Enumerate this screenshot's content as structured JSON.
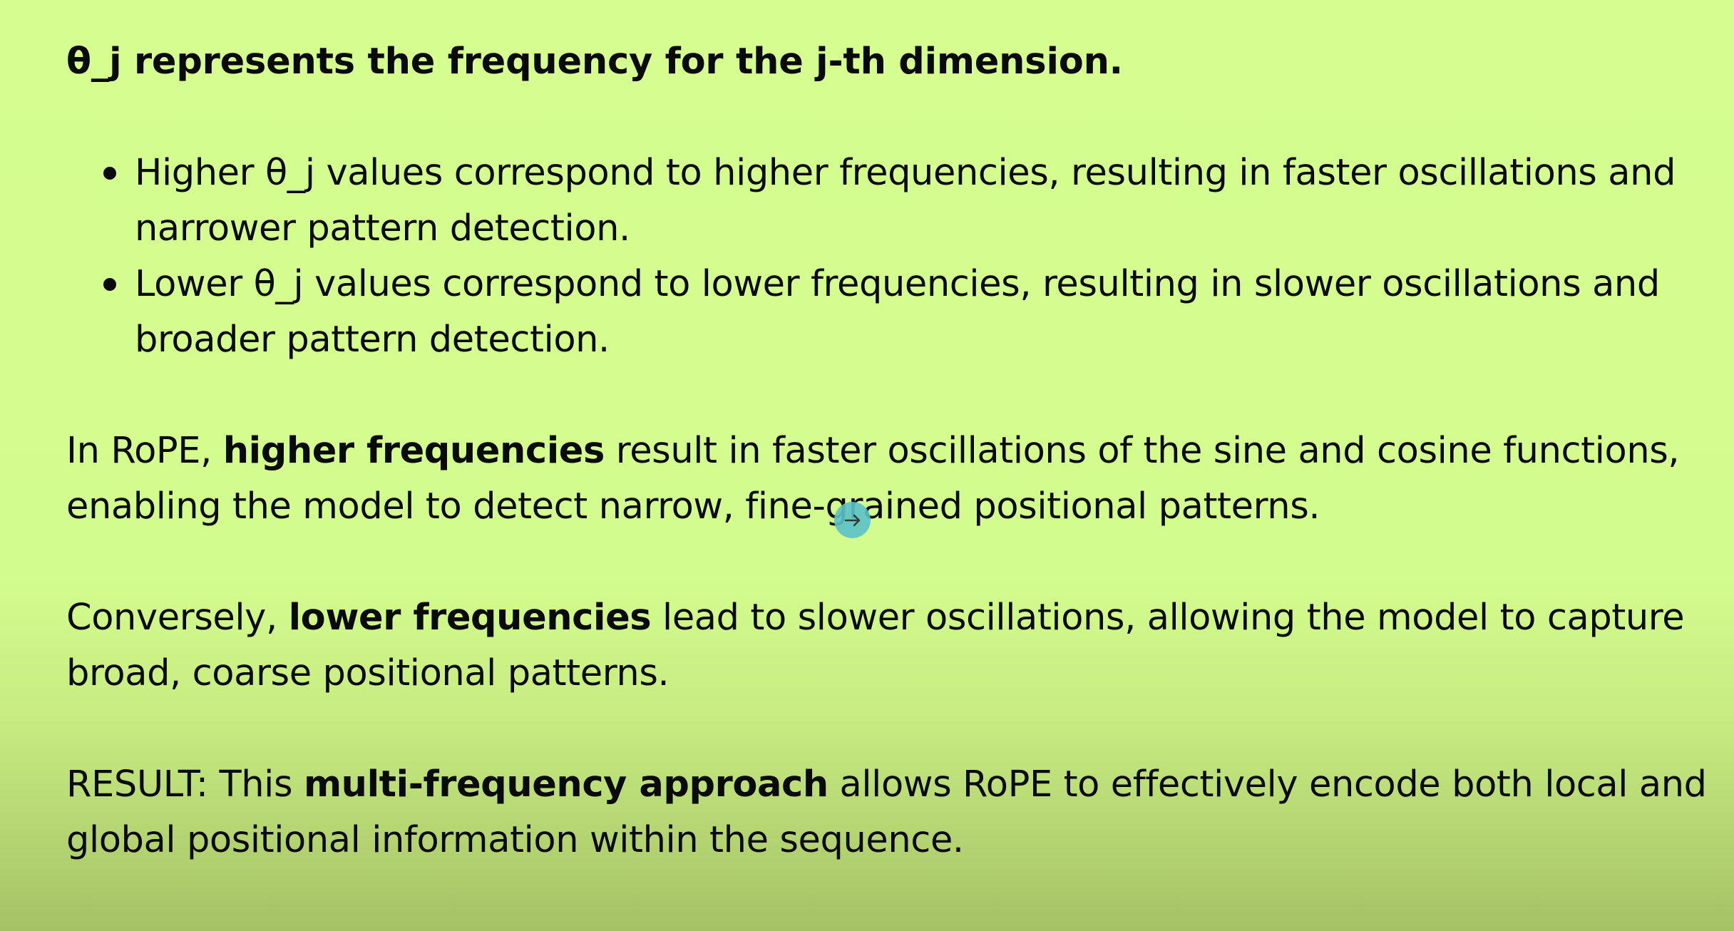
{
  "heading": "θ_j represents the frequency for the j-th dimension.",
  "bullets": [
    "Higher θ_j values correspond to higher frequencies, resulting in faster oscillations and narrower pattern detection.",
    "Lower θ_j values correspond to lower frequencies, resulting in slower oscillations and broader pattern detection."
  ],
  "paragraphs": [
    {
      "before": "In RoPE, ",
      "bold": "higher frequencies",
      "after": " result in faster oscillations of the sine and cosine functions, enabling the model to detect narrow, fine-grained positional patterns."
    },
    {
      "before": "Conversely, ",
      "bold": "lower frequencies",
      "after": " lead to slower oscillations, allowing the model to capture broad, coarse positional patterns."
    },
    {
      "before": "RESULT: This ",
      "bold": "multi-frequency approach",
      "after": " allows RoPE to effectively encode both local and global positional information within the sequence."
    }
  ],
  "cursor_icon": "arrow-right-icon",
  "colors": {
    "background_top": "#d5fd8f",
    "background_bottom": "#a5c264",
    "cursor": "#5cc2c8"
  }
}
